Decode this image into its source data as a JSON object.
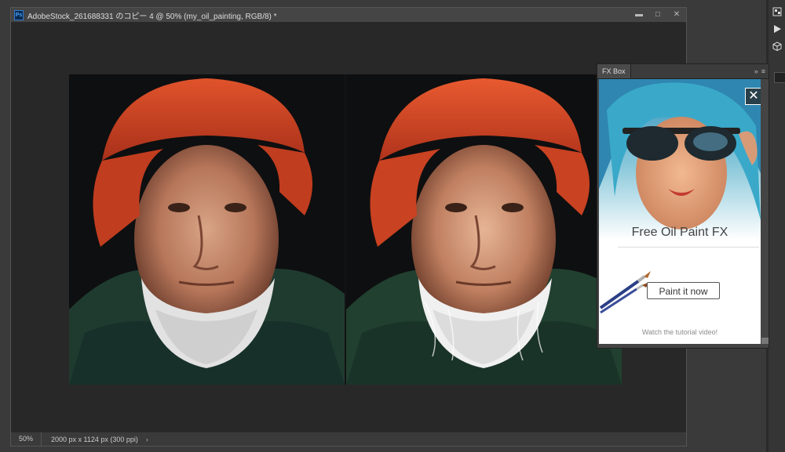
{
  "document": {
    "title": "AdobeStock_261688331 のコピー 4 @ 50% (my_oil_painting, RGB/8) *",
    "app_icon": "Ps",
    "controls": {
      "minimize": "▬",
      "maximize": "□",
      "close": "✕"
    }
  },
  "status_bar": {
    "zoom": "50%",
    "doc_info": "2000 px x 1124 px (300 ppi)",
    "arrow": "›"
  },
  "right_strip": {
    "icons": [
      "history-icon",
      "play-icon",
      "3d-cube-icon"
    ]
  },
  "fx_panel": {
    "tab_label": "FX Box",
    "expand": "»",
    "menu": "≡",
    "close_symbol": "✕",
    "title": "Free Oil Paint FX",
    "button_label": "Paint it now",
    "tutorial_link": "Watch the tutorial video!"
  },
  "colors": {
    "accent_hat": "#d2401d",
    "hoodie": "#1f3b30",
    "hair_teal": "#3aa9c9"
  }
}
